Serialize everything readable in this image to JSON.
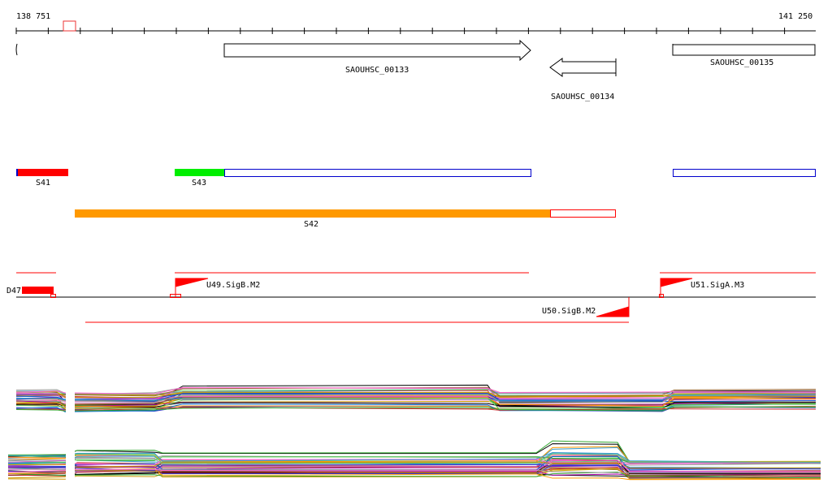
{
  "ruler": {
    "start": "138 751",
    "end": "141 250"
  },
  "genes": [
    {
      "name": "SAOUHSC_00133"
    },
    {
      "name": "SAOUHSC_00134"
    },
    {
      "name": "SAOUHSC_00135"
    }
  ],
  "segments": [
    {
      "name": "S41",
      "color": "#ff0000"
    },
    {
      "name": "S43",
      "color": "#00ee00"
    },
    {
      "name": "S42",
      "color": "#ff9900"
    }
  ],
  "promoters": [
    {
      "name": "D47"
    },
    {
      "name": "U49.SigB.M2"
    },
    {
      "name": "U50.SigB.M2"
    },
    {
      "name": "U51.SigA.M3"
    }
  ],
  "colors": {
    "outline_blue": "#0000cc",
    "outline_red": "#ff0000"
  }
}
